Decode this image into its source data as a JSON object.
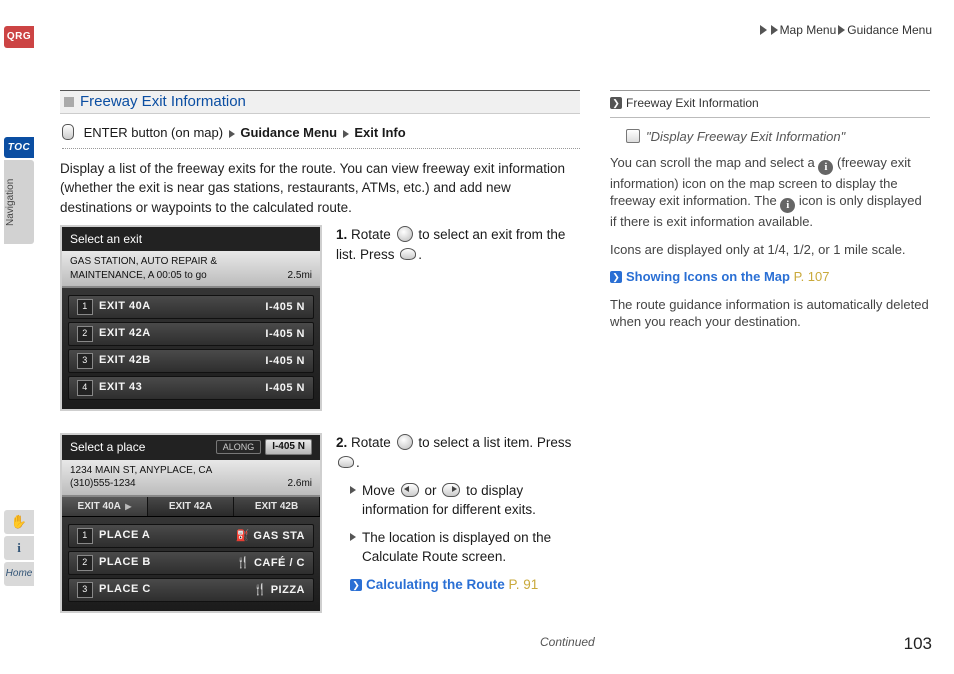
{
  "breadcrumb": {
    "a": "Map Menu",
    "b": "Guidance Menu"
  },
  "rail": {
    "qrg": "QRG",
    "toc": "TOC",
    "nav": "Navigation",
    "home": "Home"
  },
  "section": {
    "title": "Freeway Exit Information",
    "path_a": "ENTER button (on map)",
    "path_b": "Guidance Menu",
    "path_c": "Exit Info",
    "intro": "Display a list of the freeway exits for the route. You can view freeway exit information (whether the exit is near gas stations, restaurants, ATMs, etc.) and add new destinations or waypoints to the calculated route."
  },
  "mock1": {
    "title": "Select an exit",
    "sub1": "GAS STATION, AUTO REPAIR &",
    "sub2": "MAINTENANCE, A  00:05 to go",
    "dist": "2.5mi",
    "rows": [
      {
        "n": "1",
        "name": "EXIT 40A",
        "rt": "I-405 N"
      },
      {
        "n": "2",
        "name": "EXIT 42A",
        "rt": "I-405 N"
      },
      {
        "n": "3",
        "name": "EXIT 42B",
        "rt": "I-405 N"
      },
      {
        "n": "4",
        "name": "EXIT 43",
        "rt": "I-405 N"
      }
    ]
  },
  "mock2": {
    "title": "Select a place",
    "along": "ALONG",
    "route": "I-405 N",
    "addr1": "1234 MAIN ST, ANYPLACE, CA",
    "addr2": "(310)555-1234",
    "dist": "2.6mi",
    "tabs": [
      {
        "label": "EXIT 40A",
        "active": true
      },
      {
        "label": "EXIT 42A",
        "active": false
      },
      {
        "label": "EXIT 42B",
        "active": false
      }
    ],
    "rows": [
      {
        "n": "1",
        "name": "PLACE A",
        "cat": "GAS STA"
      },
      {
        "n": "2",
        "name": "PLACE B",
        "cat": "CAFÉ / C"
      },
      {
        "n": "3",
        "name": "PLACE C",
        "cat": "PIZZA"
      }
    ]
  },
  "steps": {
    "s1a": "Rotate",
    "s1b": "to select an exit from the list. Press",
    "s1n": "1.",
    "s2n": "2.",
    "s2a": "Rotate",
    "s2b": "to select a list item. Press",
    "s2_li1a": "Move",
    "s2_li1b": "or",
    "s2_li1c": "to display information for different exits.",
    "s2_li2": "The location is displayed on the Calculate Route screen.",
    "s2_link": "Calculating the Route",
    "s2_link_pg": "P. 91"
  },
  "side": {
    "heading": "Freeway Exit Information",
    "voice": "\"Display Freeway Exit Information\"",
    "p1a": "You can scroll the map and select a",
    "p1b": "(freeway exit information) icon on the map screen to display the freeway exit information. The",
    "p1c": "icon is only displayed if there is exit information available.",
    "p2": "Icons are displayed only at 1/4, 1/2, or 1 mile scale.",
    "link": "Showing Icons on the Map",
    "link_pg": "P. 107",
    "p3": "The route guidance information is automatically deleted when you reach your destination."
  },
  "footer": {
    "continued": "Continued",
    "page": "103"
  }
}
